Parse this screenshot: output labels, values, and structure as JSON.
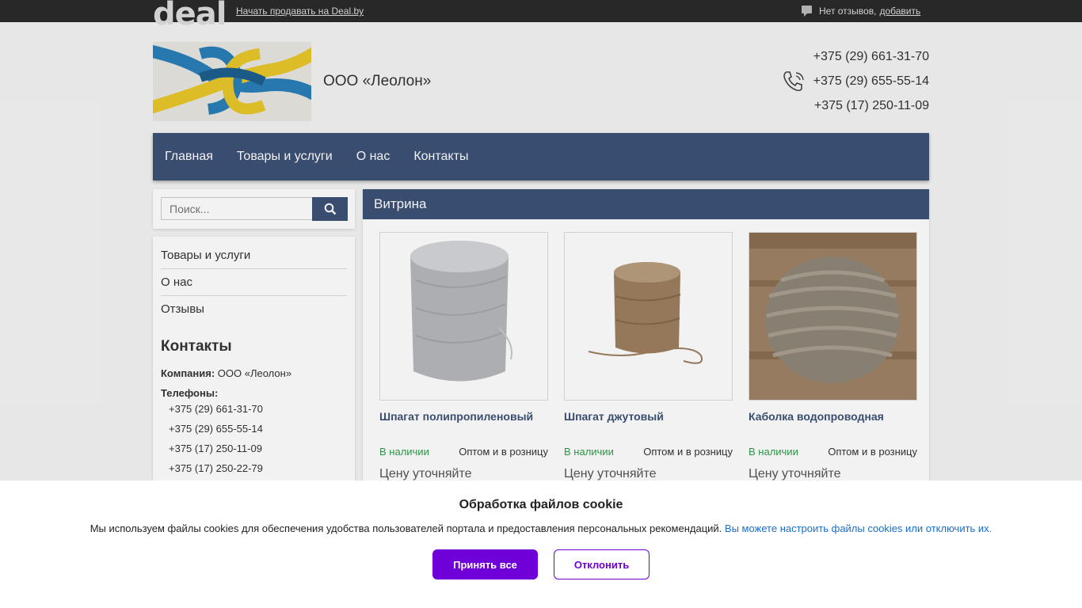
{
  "topbar": {
    "logo": "deal",
    "sell_link": "Начать продавать на Deal.by",
    "reviews_text": "Нет отзывов,",
    "reviews_add": "добавить"
  },
  "header": {
    "company_name": "ООО «Леолон»",
    "phones": [
      "+375 (29) 661-31-70",
      "+375 (29) 655-55-14",
      "+375 (17) 250-11-09"
    ]
  },
  "nav": {
    "items": [
      "Главная",
      "Товары и услуги",
      "О нас",
      "Контакты"
    ]
  },
  "sidebar": {
    "search_placeholder": "Поиск...",
    "menu": [
      "Товары и услуги",
      "О нас",
      "Отзывы"
    ],
    "contacts_title": "Контакты",
    "company_label": "Компания:",
    "company_value": "ООО «Леолон»",
    "phones_label": "Телефоны:",
    "phones": [
      "+375 (29) 661-31-70",
      "+375 (29) 655-55-14",
      "+375 (17) 250-11-09",
      "+375 (17) 250-22-79"
    ]
  },
  "showcase": {
    "title": "Витрина",
    "products": [
      {
        "name": "Шпагат полипропиленовый",
        "stock": "В наличии",
        "sale": "Оптом и в розницу",
        "price": "Цену уточняйте"
      },
      {
        "name": "Шпагат джутовый",
        "stock": "В наличии",
        "sale": "Оптом и в розницу",
        "price": "Цену уточняйте"
      },
      {
        "name": "Каболка водопроводная",
        "stock": "В наличии",
        "sale": "Оптом и в розницу",
        "price": "Цену уточняйте"
      }
    ]
  },
  "cookie": {
    "title": "Обработка файлов cookie",
    "text": "Мы используем файлы cookies для обеспечения удобства пользователей портала и предоставления персональных рекомендаций.",
    "link": "Вы можете настроить файлы cookies или отключить их.",
    "accept": "Принять все",
    "decline": "Отклонить"
  },
  "colors": {
    "nav": "#3d5277",
    "accent": "#6f00d8",
    "stock": "#2e9d4a",
    "link": "#1a6fc9"
  }
}
